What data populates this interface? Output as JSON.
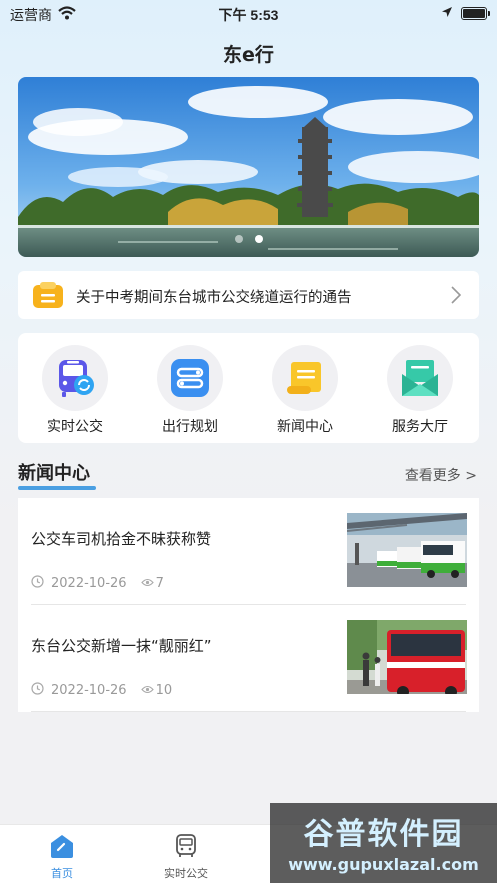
{
  "status_bar": {
    "carrier": "运营商",
    "time": "下午 5:53"
  },
  "nav": {
    "title": "东e行"
  },
  "banner": {
    "pages": 2,
    "active_page": 2
  },
  "notice": {
    "text": "关于中考期间东台城市公交绕道运行的通告"
  },
  "quick_menu": [
    {
      "label": "实时公交",
      "icon": "bus-realtime-icon"
    },
    {
      "label": "出行规划",
      "icon": "route-plan-icon"
    },
    {
      "label": "新闻中心",
      "icon": "news-scroll-icon"
    },
    {
      "label": "服务大厅",
      "icon": "service-envelope-icon"
    }
  ],
  "news_section": {
    "title": "新闻中心",
    "more": "查看更多 >"
  },
  "news": [
    {
      "title": "公交车司机拾金不昧获称赞",
      "date": "2022-10-26",
      "views": "7"
    },
    {
      "title": "东台公交新增一抹“靓丽红”",
      "date": "2022-10-26",
      "views": "10"
    }
  ],
  "tabbar": [
    {
      "label": "首页",
      "active": true
    },
    {
      "label": "实时公交",
      "active": false
    }
  ],
  "watermark": {
    "line1": "谷普软件园",
    "line2": "www.gupuxlazal.com"
  },
  "colors": {
    "accent": "#4a9fe2",
    "active_tab": "#3b8fe0",
    "inactive_tab": "#555555"
  }
}
